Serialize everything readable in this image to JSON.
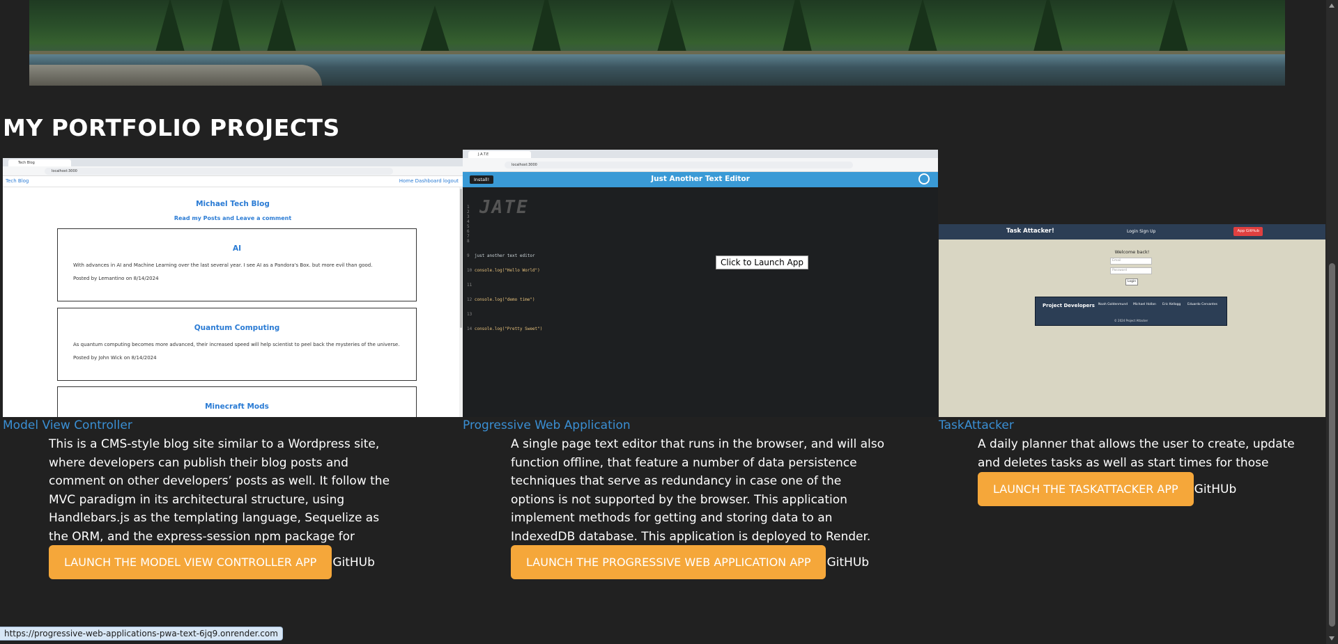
{
  "page": {
    "heading": "MY PORTFOLIO PROJECTS"
  },
  "projects": [
    {
      "title": "Model View Controller",
      "description": "This is a CMS-style blog site similar to a Wordpress site, where developers can publish their blog posts and comment on other developers’ posts as well. It follow the MVC paradigm in its architectural structure, using Handlebars.js as the templating language, Sequelize as the ORM, and the express-session npm package for authentication.",
      "launch_label": "LAUNCH THE MODEL VIEW CONTROLLER APP",
      "github_label": "GitHUb",
      "screenshot": {
        "tab_title": "Tech Blog",
        "url": "localhost:3000",
        "nav_brand": "Tech Blog",
        "nav_links": "Home Dashboard logout",
        "blog_title": "Michael Tech Blog",
        "blog_subtitle": "Read my Posts and Leave a comment",
        "posts": [
          {
            "title": "AI",
            "body": "With advances in AI and Machine Learning over the last several year. I see AI as a Pandora's Box. but more evil than good.",
            "meta": "Posted by Lemantino on 8/14/2024"
          },
          {
            "title": "Quantum Computing",
            "body": "As quantum computing becomes more advanced, their increased speed will help scientist to peel back the mysteries of the universe.",
            "meta": "Posted by John Wick on 8/14/2024"
          },
          {
            "title": "Minecraft Mods",
            "body": "",
            "meta": ""
          }
        ]
      }
    },
    {
      "title": "Progressive Web Application",
      "description": "A single page text editor that runs in the browser, and will also function offline, that feature a number of data persistence techniques that serve as redundancy in case one of the options is not supported by the browser. This application implement methods for getting and storing data to an IndexedDB database. This application is deployed to Render.",
      "launch_label": "LAUNCH THE PROGRESSIVE WEB APPLICATION APP",
      "github_label": "GitHUb",
      "screenshot": {
        "tab_title": "J.A.T.E",
        "url": "localhost:3000",
        "install_label": "Install!",
        "editor_title": "Just Another Text Editor",
        "logo_text": "JATE",
        "tagline": "just another text editor",
        "code_lines": [
          "console.log(\"Hello World\")",
          "console.log(\"demo time\")",
          "console.log(\"Pretty Sweet\")"
        ],
        "overlay_label": "Click to Launch App"
      }
    },
    {
      "title": "TaskAttacker",
      "description": "A daily planner that allows the user to create, update and deletes tasks as well as start times for those tasks.",
      "launch_label": "LAUNCH THE TASKATTACKER APP",
      "github_label": "GitHUb",
      "screenshot": {
        "brand": "Task Attacker!",
        "nav_links": "Login   Sign Up",
        "app_github": "App GitHub",
        "welcome": "Welcome back!",
        "email_placeholder": "Email",
        "password_placeholder": "Password",
        "login_label": "Login",
        "footer_title": "Project Developers",
        "developers": [
          "Noah Goldenmund",
          "Michael Hollan",
          "Eric Kellogg",
          "Eduardo Cervantes"
        ],
        "copyright": "© 2024 Project Attacker"
      }
    }
  ],
  "status_bar": {
    "url": "https://progressive-web-applications-pwa-text-6jq9.onrender.com"
  },
  "colors": {
    "background": "#212121",
    "link": "#3a8fd4",
    "button": "#f5a73a"
  }
}
